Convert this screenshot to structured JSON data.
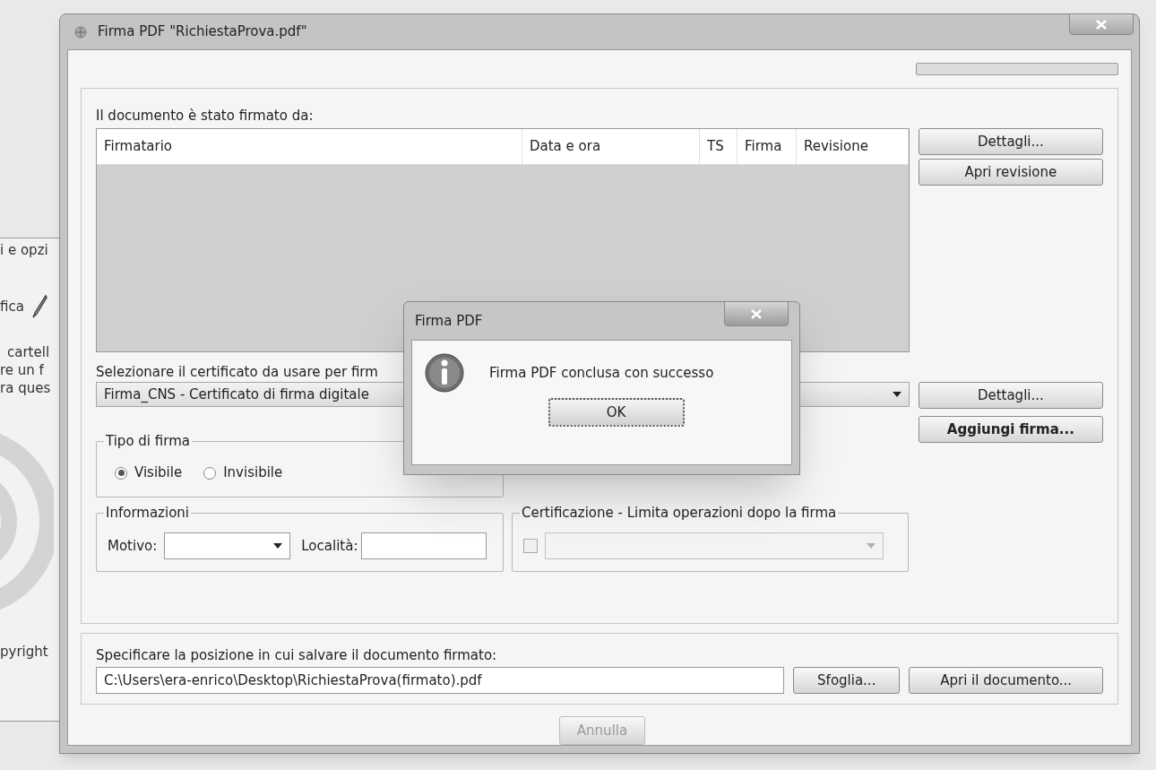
{
  "background_window": {
    "fragments": [
      "i e opzi",
      "fica",
      "cartell",
      "re un f",
      "ra ques",
      "pyright"
    ]
  },
  "window": {
    "title": "Firma PDF \"RichiestaProva.pdf\""
  },
  "progress": {
    "level": 0
  },
  "signed_by": {
    "label": "Il documento è stato firmato da:",
    "columns": [
      "Firmatario",
      "Data e ora",
      "TS",
      "Firma",
      "Revisione"
    ]
  },
  "signature_buttons": [
    "Dettagli...",
    "Apri revisione"
  ],
  "certificate": {
    "label": "Selezionare il certificato da usare per firm",
    "value": "Firma_CNS - Certificato di firma digitale"
  },
  "certificate_buttons": [
    {
      "label": "Dettagli...",
      "kind": "normal"
    },
    {
      "label": "Aggiungi firma...",
      "kind": "default"
    }
  ],
  "signature_type": {
    "title": "Tipo di firma",
    "options": [
      {
        "label": "Visibile",
        "selected": true
      },
      {
        "label": "Invisibile",
        "selected": false
      }
    ]
  },
  "information": {
    "title": "Informazioni",
    "reason_label": "Motivo:",
    "location_label": "Località:"
  },
  "certification": {
    "title": "Certificazione - Limita operazioni dopo la firma",
    "checked": false,
    "disabled": true
  },
  "output": {
    "label": "Specificare la posizione in cui salvare il documento firmato:",
    "path": "C:\\Users\\era-enrico\\Desktop\\RichiestaProva(firmato).pdf",
    "buttons": [
      "Sfoglia...",
      "Apri il documento..."
    ]
  },
  "cancel": {
    "label": "Annulla",
    "disabled": true
  },
  "message_box": {
    "title": "Firma PDF",
    "message": "Firma PDF conclusa con successo",
    "button": "OK"
  }
}
